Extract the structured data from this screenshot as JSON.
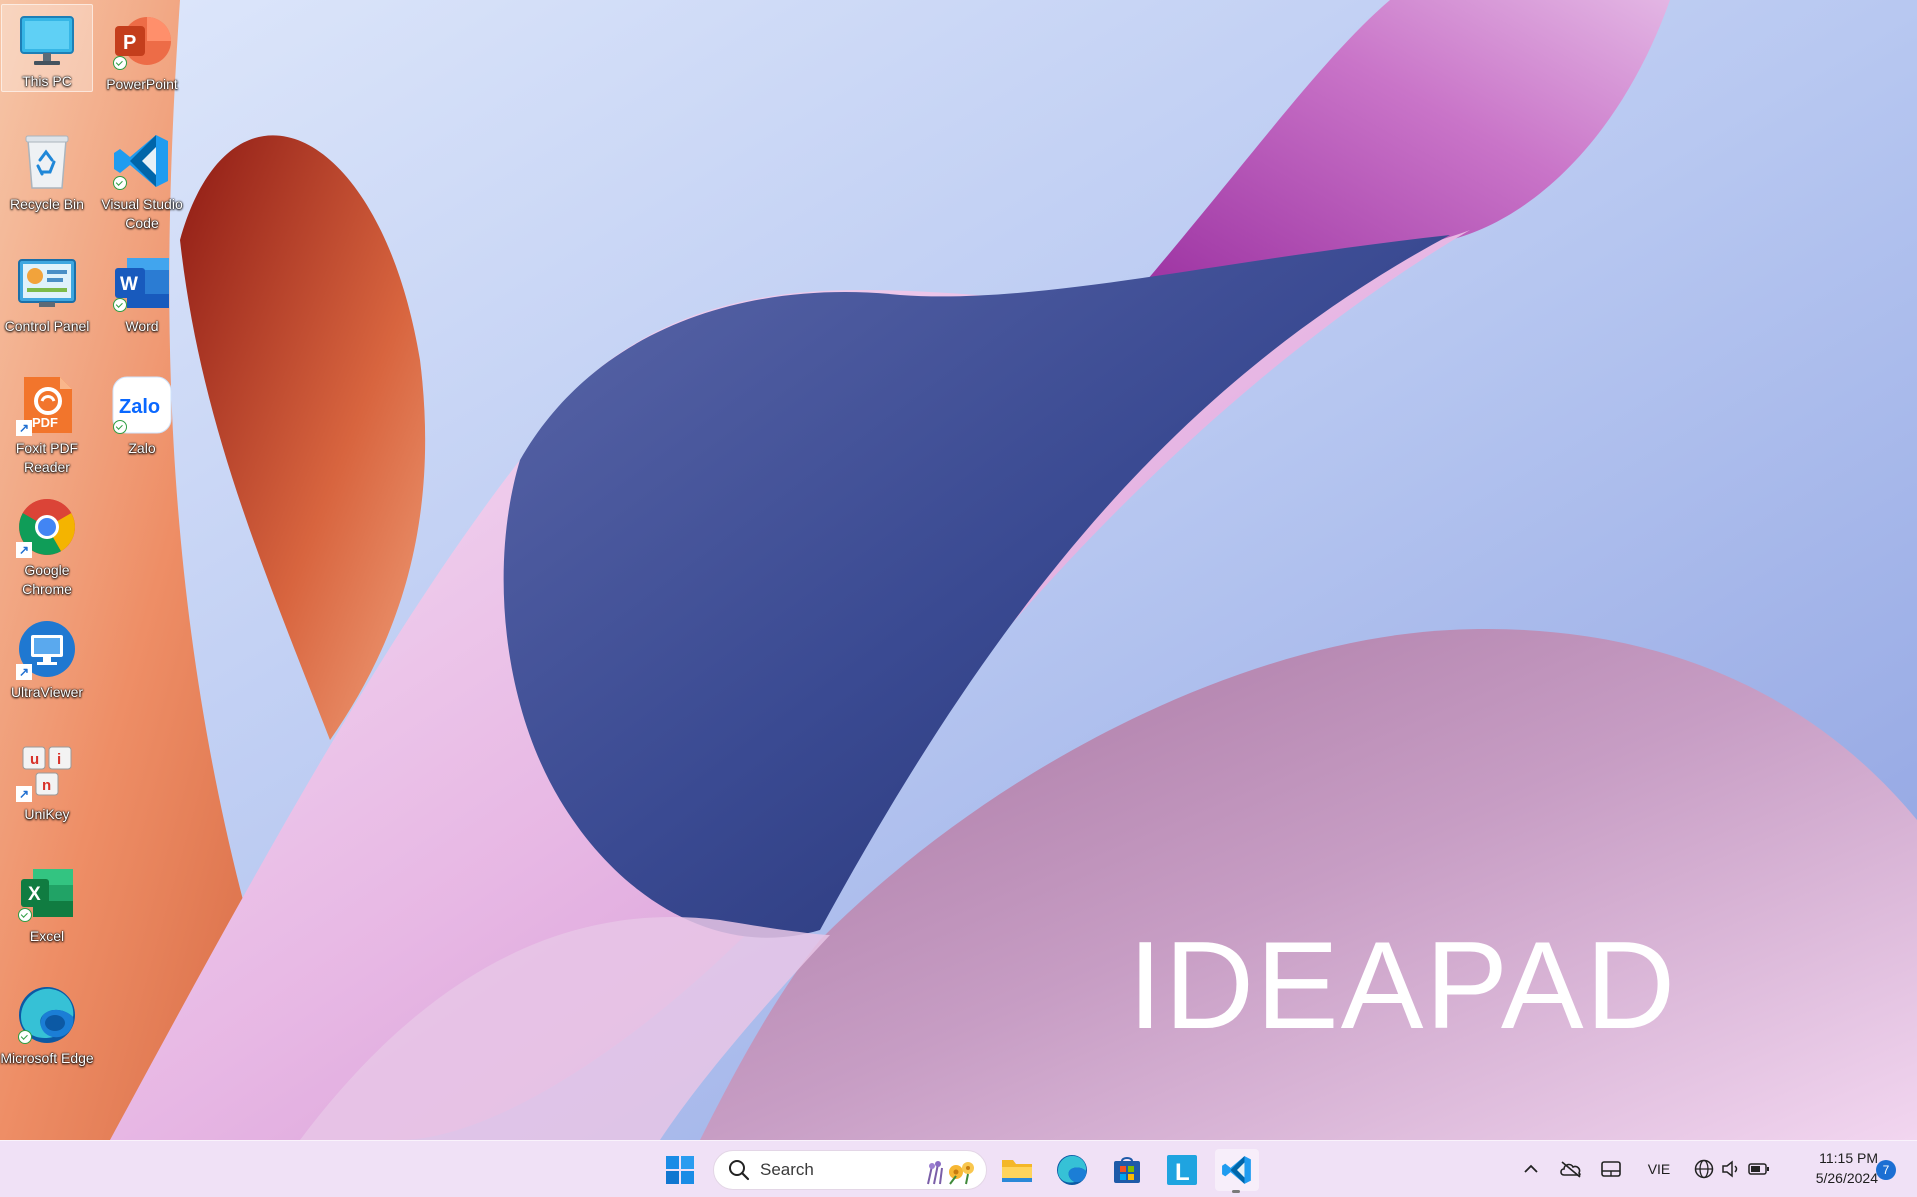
{
  "wallpaper": {
    "brand_text": "IDEAPAD"
  },
  "desktop": {
    "icons": [
      {
        "id": "this-pc",
        "label": "This PC"
      },
      {
        "id": "powerpoint",
        "label": "PowerPoint",
        "badge_letter": "P"
      },
      {
        "id": "recycle-bin",
        "label": "Recycle Bin"
      },
      {
        "id": "vscode",
        "label": "Visual Studio Code"
      },
      {
        "id": "control-panel",
        "label": "Control Panel"
      },
      {
        "id": "word",
        "label": "Word",
        "badge_letter": "W"
      },
      {
        "id": "foxit",
        "label": "Foxit PDF Reader",
        "badge_text": "PDF"
      },
      {
        "id": "zalo",
        "label": "Zalo",
        "badge_text": "Zalo"
      },
      {
        "id": "chrome",
        "label": "Google Chrome"
      },
      {
        "id": "ultraviewer",
        "label": "UltraViewer"
      },
      {
        "id": "unikey",
        "label": "UniKey",
        "keys": [
          "u",
          "i",
          "n"
        ]
      },
      {
        "id": "excel",
        "label": "Excel",
        "badge_letter": "X"
      },
      {
        "id": "edge",
        "label": "Microsoft Edge"
      }
    ]
  },
  "taskbar": {
    "search_placeholder": "Search",
    "pinned": [
      "start-icon",
      "file-explorer-icon",
      "edge-icon",
      "microsoft-store-icon",
      "l-app-icon",
      "vscode-icon"
    ],
    "l_app_letter": "L",
    "tray": {
      "language": "VIE",
      "time": "11:15 PM",
      "date": "5/26/2024",
      "notification_count": "7"
    }
  },
  "colors": {
    "taskbar_bg": "#f3e2f6",
    "accent_blue": "#1c6fd3"
  }
}
